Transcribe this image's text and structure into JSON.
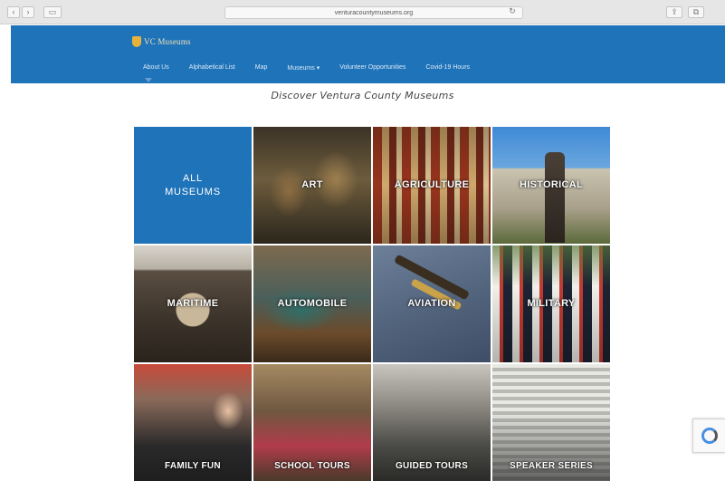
{
  "browser": {
    "url": "venturacountymuseums.org",
    "back_icon": "chevron-left",
    "forward_icon": "chevron-right",
    "sidebar_icon": "sidebar",
    "reload_icon": "reload",
    "share_icon": "share",
    "tabs_icon": "tabs"
  },
  "header": {
    "logo_text": "VC Museums",
    "nav": [
      {
        "label": "About Us"
      },
      {
        "label": "Alphabetical List"
      },
      {
        "label": "Map"
      },
      {
        "label": "Museums ▾"
      },
      {
        "label": "Volunteer Opportunities"
      },
      {
        "label": "Covid-19 Hours"
      }
    ]
  },
  "page": {
    "heading": "Discover Ventura County Museums"
  },
  "tiles": [
    {
      "label": "ALL MUSEUMS"
    },
    {
      "label": "ART"
    },
    {
      "label": "AGRICULTURE"
    },
    {
      "label": "HISTORICAL"
    },
    {
      "label": "MARITIME"
    },
    {
      "label": "AUTOMOBILE"
    },
    {
      "label": "AVIATION"
    },
    {
      "label": "MILITARY"
    },
    {
      "label": "FAMILY FUN"
    },
    {
      "label": "SCHOOL TOURS"
    },
    {
      "label": "GUIDED TOURS"
    },
    {
      "label": "SPEAKER SERIES"
    }
  ],
  "colors": {
    "brand_blue": "#1f73b9",
    "logo_gold": "#e8b13a"
  }
}
